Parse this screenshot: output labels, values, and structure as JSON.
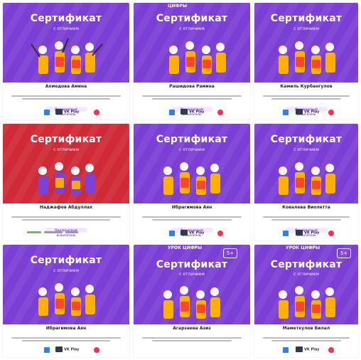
{
  "certificate": {
    "title": "Сертификат",
    "subtitle": "с отличием",
    "button_label": "Пролиантный испытатель"
  },
  "brand": {
    "logo_text": "УРОК ЦИФРЫ",
    "logo_text_cut": "ЦИФРЫ",
    "age_badge": "5+"
  },
  "sponsors": {
    "vk_play": "VK Play"
  },
  "cards": [
    {
      "name": "Ахмедова Амина",
      "theme": "purple"
    },
    {
      "name": "Рашидова Рамина",
      "theme": "purple"
    },
    {
      "name": "Камиль Курбангулов",
      "theme": "purple"
    },
    {
      "name": "Наджафов Абдуллах",
      "theme": "red"
    },
    {
      "name": "Ибрагимова Аян",
      "theme": "purple"
    },
    {
      "name": "Ковалева Виолетта",
      "theme": "purple"
    },
    {
      "name": "Ибрагимова Аян",
      "theme": "purple"
    },
    {
      "name": "Агарзаева Азиз",
      "theme": "purple"
    },
    {
      "name": "Маметкулов Билал",
      "theme": "purple"
    }
  ]
}
